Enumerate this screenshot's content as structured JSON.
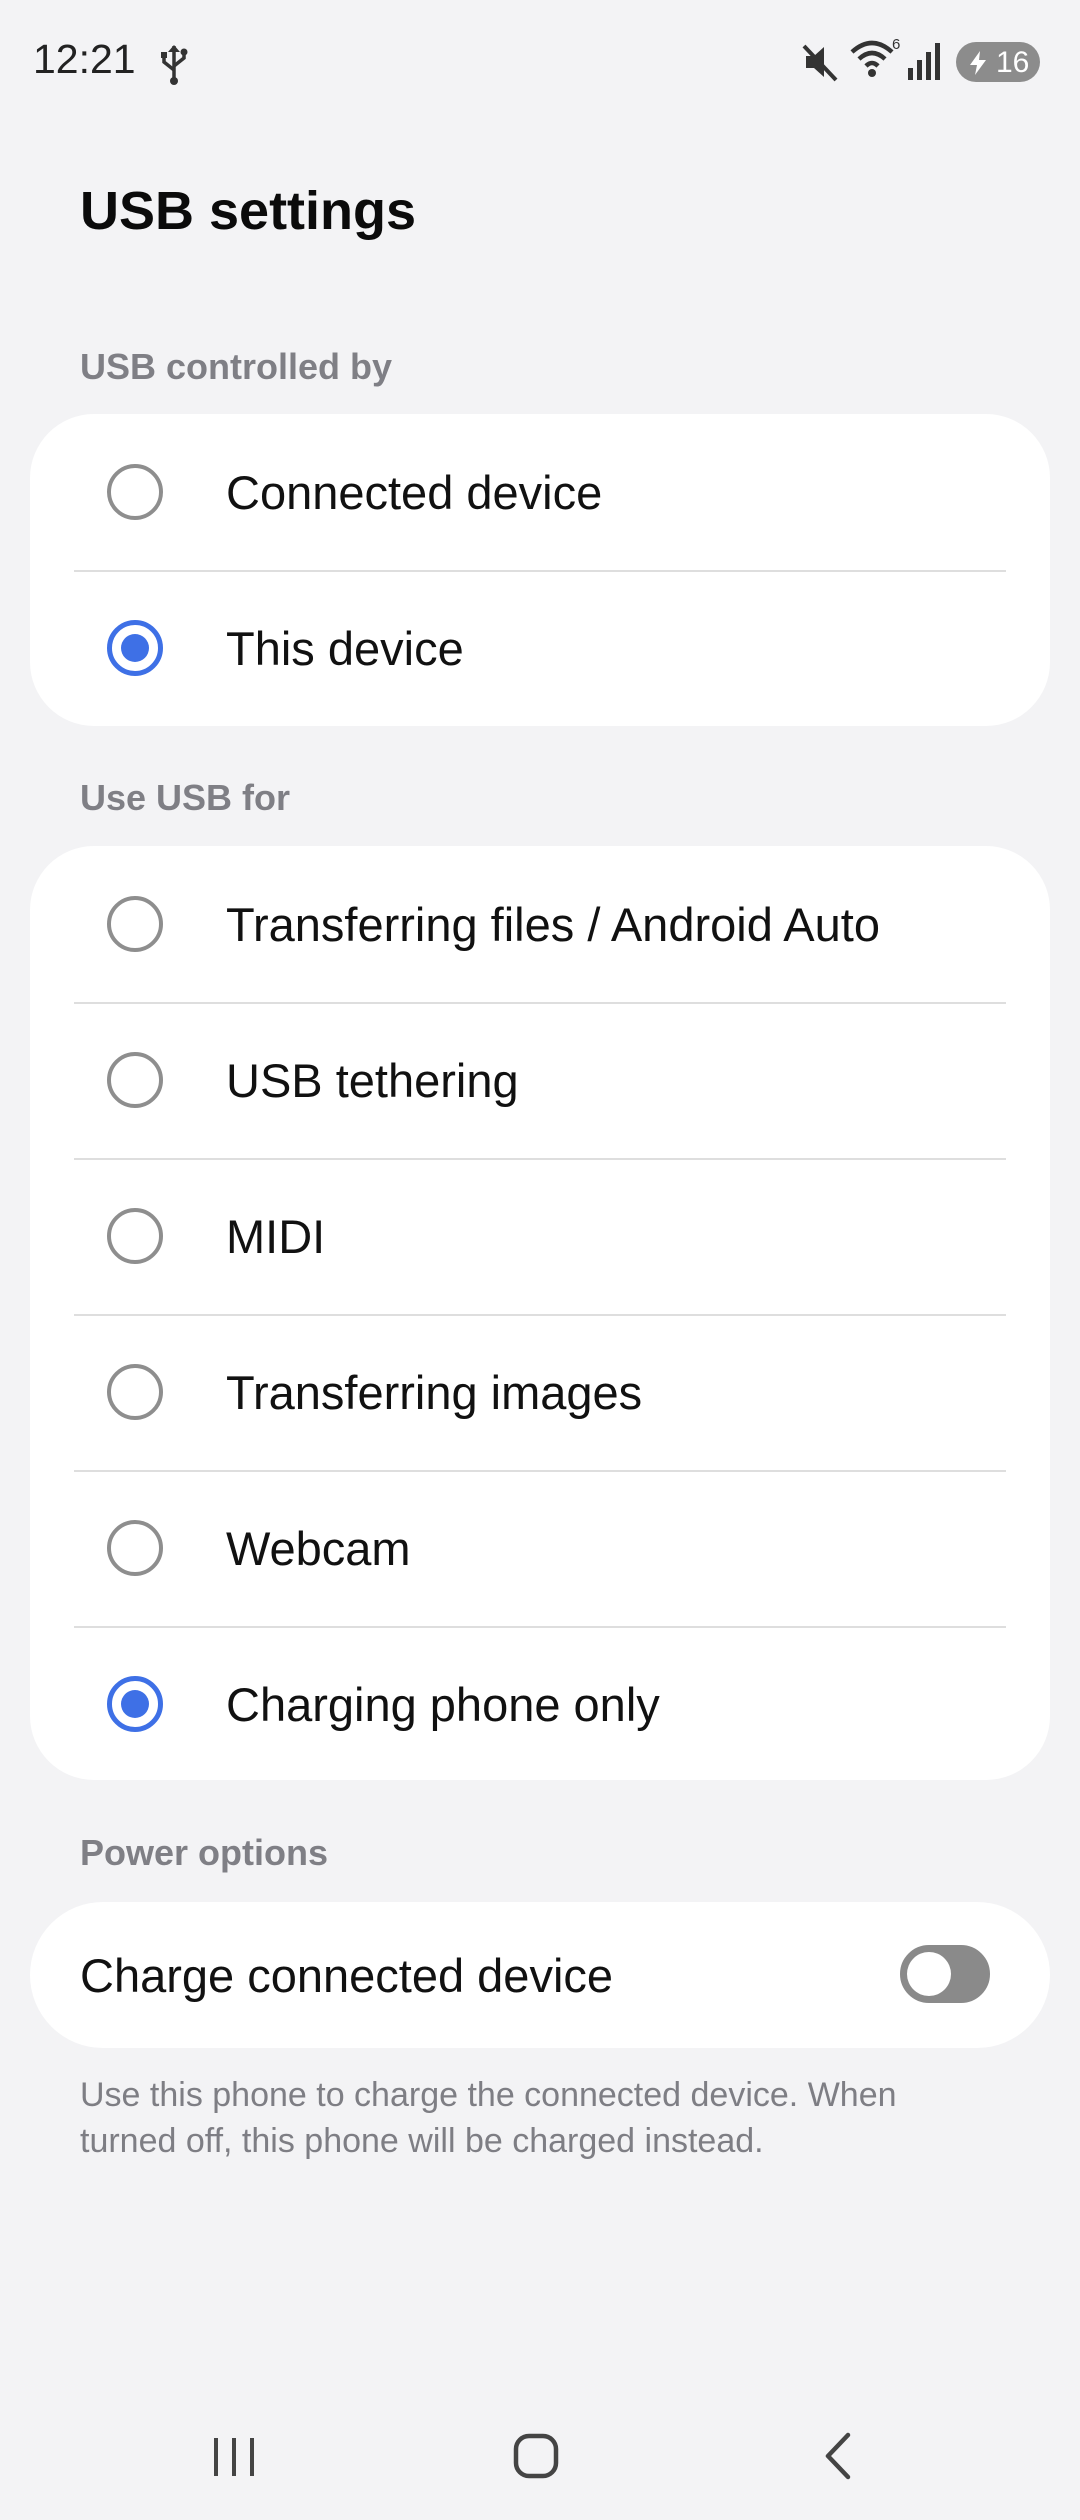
{
  "status_bar": {
    "time": "12:21",
    "battery_level": "16",
    "wifi_badge": "6",
    "icons": [
      "usb-icon",
      "mute-icon",
      "wifi-icon",
      "signal-icon",
      "battery-charging-icon"
    ]
  },
  "page": {
    "title": "USB settings"
  },
  "controlled_by": {
    "header": "USB controlled by",
    "options": [
      {
        "label": "Connected device",
        "selected": false
      },
      {
        "label": "This device",
        "selected": true
      }
    ]
  },
  "use_usb_for": {
    "header": "Use USB for",
    "options": [
      {
        "label": "Transferring files / Android Auto",
        "selected": false
      },
      {
        "label": "USB tethering",
        "selected": false
      },
      {
        "label": "MIDI",
        "selected": false
      },
      {
        "label": "Transferring images",
        "selected": false
      },
      {
        "label": "Webcam",
        "selected": false
      },
      {
        "label": "Charging phone only",
        "selected": true
      }
    ]
  },
  "power_options": {
    "header": "Power options",
    "charge_label": "Charge connected device",
    "charge_enabled": false,
    "description": "Use this phone to charge the connected device. When turned off, this phone will be charged instead."
  },
  "nav_bar": {
    "buttons": [
      "recent-apps-icon",
      "home-icon",
      "back-icon"
    ]
  },
  "colors": {
    "accent": "#3e70e6",
    "background": "#f3f3f5",
    "card": "#ffffff",
    "section_header": "#7f7f85"
  }
}
